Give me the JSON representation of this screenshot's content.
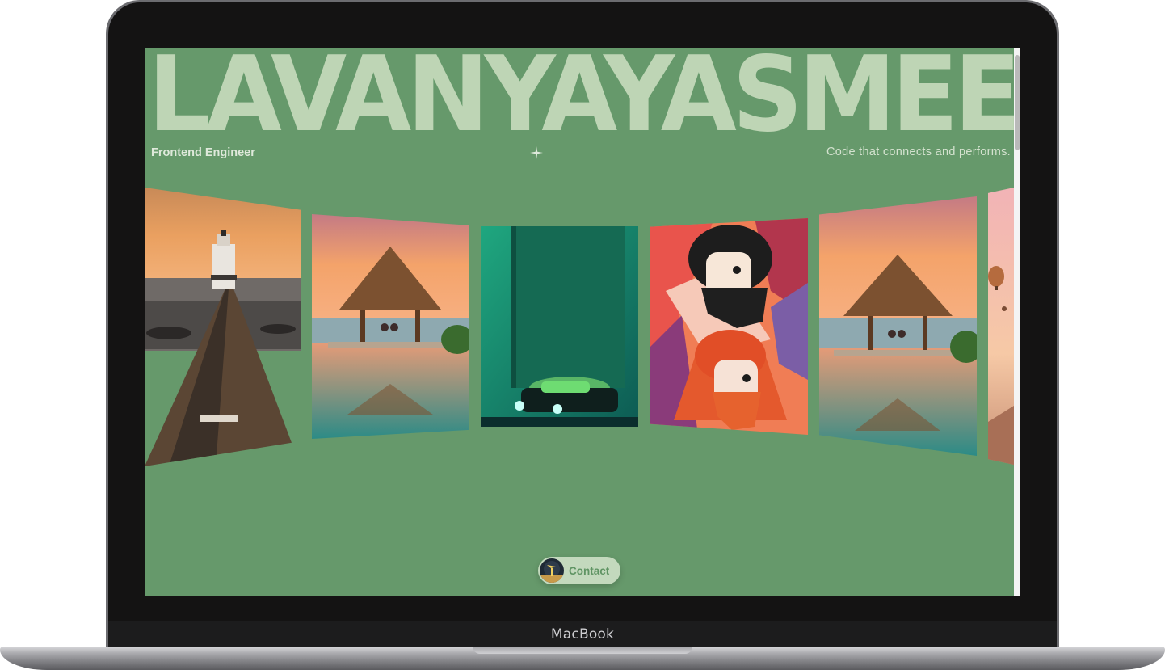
{
  "device": {
    "brand_label": "MacBook"
  },
  "hero": {
    "name": "LAVANYAYASMEEN",
    "role": "Frontend Engineer",
    "tagline": "Code that connects and performs."
  },
  "carousel": {
    "items": [
      {
        "subject": "lighthouse at end of pier at sunset"
      },
      {
        "subject": "thatched gazebo by infinity pool at sunset"
      },
      {
        "subject": "car with headlights before a green monolith"
      },
      {
        "subject": "two bearded men in colorful abstract portrait"
      },
      {
        "subject": "thatched gazebo by infinity pool at sunset"
      },
      {
        "subject": "hot air balloons in a pink sky"
      }
    ]
  },
  "contact": {
    "label": "Contact",
    "icon": "avatar-icon"
  },
  "colors": {
    "background": "#66996b",
    "title": "#bed5b5",
    "pill": "#c3d9bd",
    "pill_text": "#5f9463"
  }
}
